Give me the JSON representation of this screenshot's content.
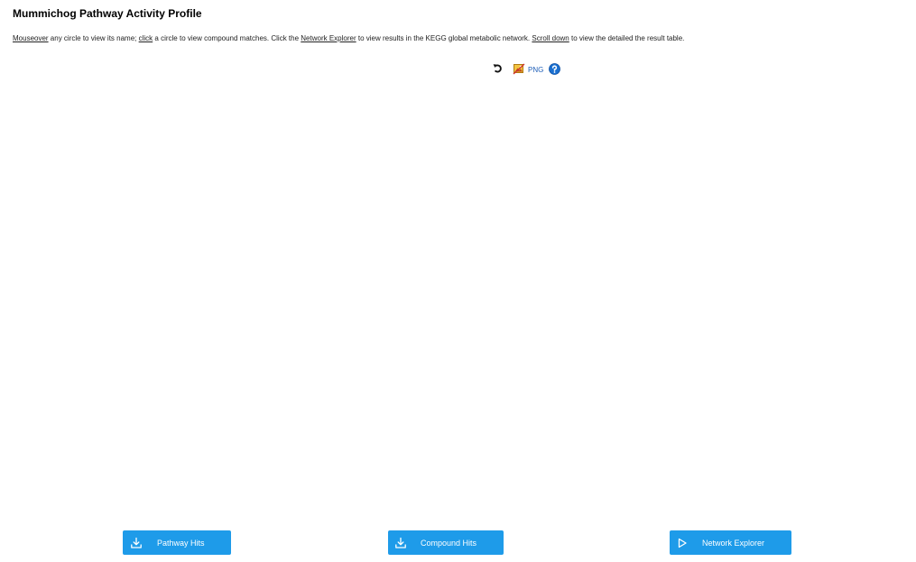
{
  "header": {
    "title": "Mummichog Pathway Activity Profile"
  },
  "instructions": {
    "mouseover_link": "Mouseover",
    "text1": " any circle to view its name; ",
    "click_link": "click",
    "text2": " a circle to view compound matches. Click the ",
    "network_link": "Network Explorer",
    "text3": " to view results in the KEGG global metabolic network. ",
    "scroll_link": "Scroll down",
    "text4": " to view the detailed the result table."
  },
  "toolbar": {
    "reset_icon": "reset-icon",
    "image_icon": "image-export-icon",
    "png_label": "PNG",
    "help_icon": "help-icon"
  },
  "buttons": {
    "pathway_hits": "Pathway Hits",
    "compound_hits": "Compound Hits",
    "network_explorer": "Network Explorer"
  },
  "colors": {
    "button_bg": "#1e9be9",
    "link_blue": "#1f5fb8",
    "help_blue": "#1a6fd0"
  }
}
